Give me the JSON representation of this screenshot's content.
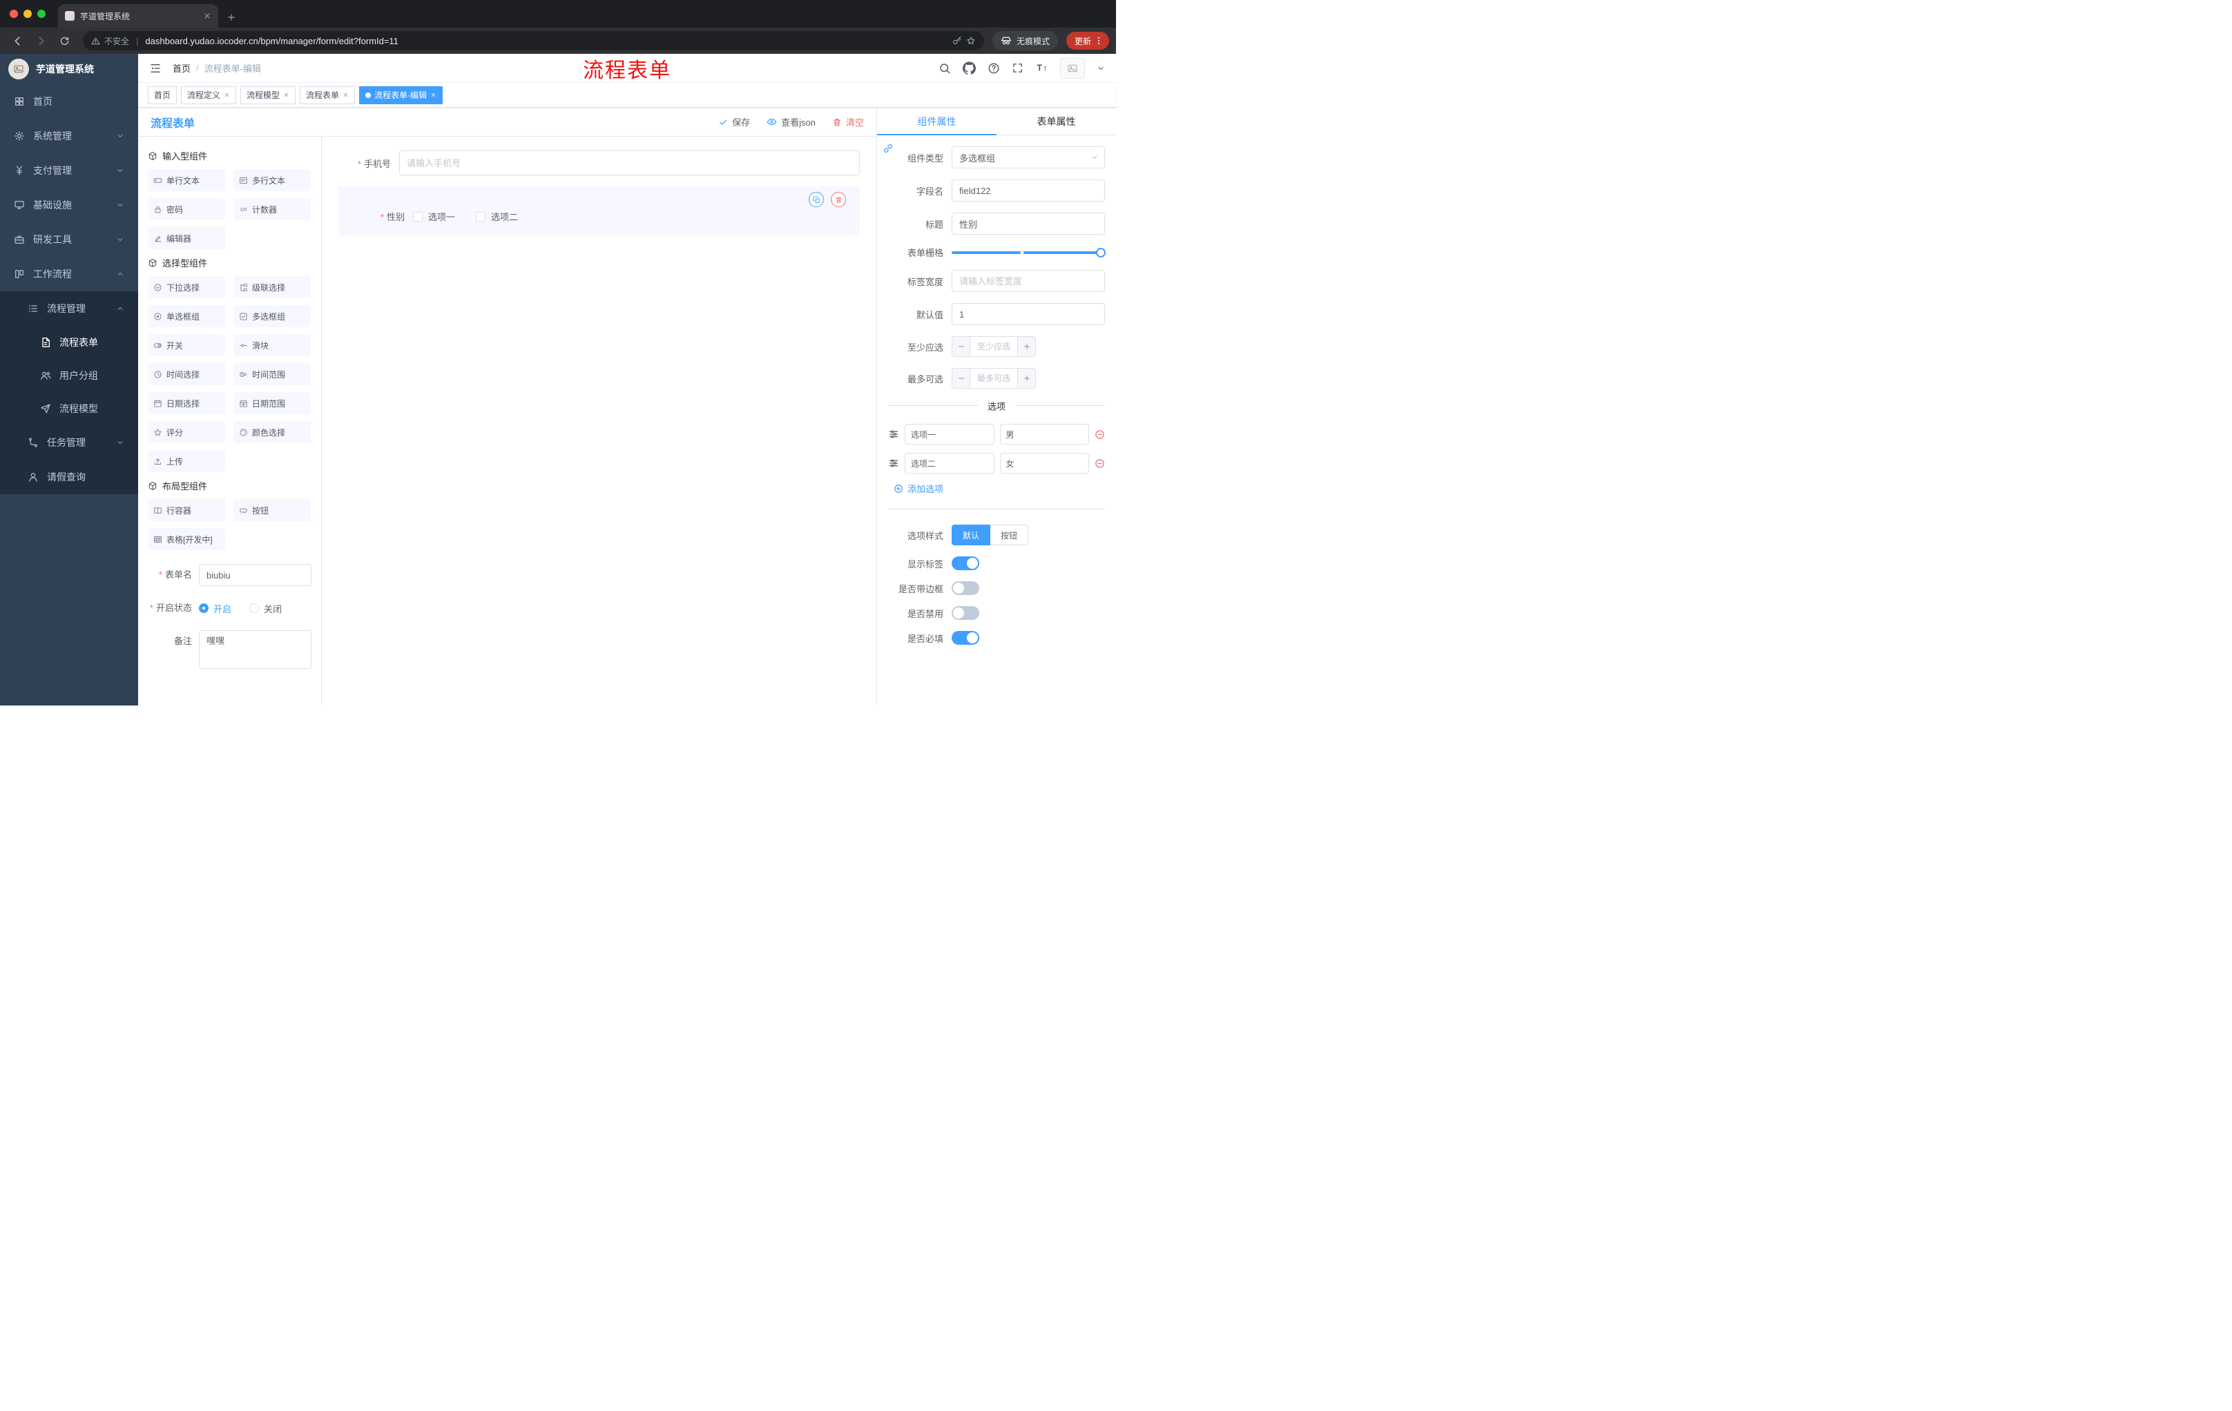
{
  "colors": {
    "accent": "#409EFF",
    "danger": "#F56C6C",
    "annotation_red": "#F50F0F",
    "sidebar_bg": "#304156",
    "submenu_bg": "#1F2D3D",
    "active_tag": "#409EFF"
  },
  "icons": [
    "search",
    "github",
    "help",
    "fullscreen",
    "font-size",
    "fold-menu",
    "chevron-down",
    "chevron-up",
    "back",
    "forward",
    "reload",
    "warning",
    "key",
    "star",
    "incognito",
    "more-vertical",
    "close",
    "plus",
    "check",
    "eye",
    "trash",
    "copy",
    "link",
    "plus-circle",
    "minus-circle",
    "drag-handle",
    "image-placeholder"
  ],
  "browser": {
    "tab": {
      "title": "芋道管理系统"
    },
    "address": {
      "security": "不安全",
      "url": "dashboard.yudao.iocoder.cn/bpm/manager/form/edit?formId=11"
    },
    "incognito_label": "无痕模式",
    "update_label": "更新"
  },
  "sidebar": {
    "logo_title": "芋道管理系统",
    "menu": [
      {
        "label": "首页"
      },
      {
        "label": "系统管理"
      },
      {
        "label": "支付管理"
      },
      {
        "label": "基础设施"
      },
      {
        "label": "研发工具"
      },
      {
        "label": "工作流程"
      }
    ],
    "submenu": {
      "process_mgmt": "流程管理",
      "process_form": "流程表单",
      "user_group": "用户分组",
      "process_model": "流程模型",
      "task_mgmt": "任务管理",
      "leave_query": "请假查询"
    }
  },
  "header": {
    "breadcrumb": [
      "首页",
      "流程表单-编辑"
    ],
    "separator": "/",
    "annotation": "流程表单"
  },
  "tags": [
    {
      "label": "首页",
      "closable": false,
      "active": false
    },
    {
      "label": "流程定义",
      "closable": true,
      "active": false
    },
    {
      "label": "流程模型",
      "closable": true,
      "active": false
    },
    {
      "label": "流程表单",
      "closable": true,
      "active": false
    },
    {
      "label": "流程表单-编辑",
      "closable": true,
      "active": true
    }
  ],
  "designer": {
    "title": "流程表单",
    "toolbar": {
      "save": "保存",
      "view_json": "查看json",
      "clear": "清空"
    },
    "palette": {
      "sections": [
        {
          "title": "输入型组件",
          "items": [
            "单行文本",
            "多行文本",
            "密码",
            "计数器",
            "编辑器"
          ]
        },
        {
          "title": "选择型组件",
          "items": [
            "下拉选择",
            "级联选择",
            "单选框组",
            "多选框组",
            "开关",
            "滑块",
            "时间选择",
            "时间范围",
            "日期选择",
            "日期范围",
            "评分",
            "颜色选择",
            "上传"
          ]
        },
        {
          "title": "布局型组件",
          "items": [
            "行容器",
            "按钮",
            "表格[开发中]"
          ]
        }
      ],
      "form": {
        "name_label": "表单名",
        "name_value": "biubiu",
        "status_label": "开启状态",
        "status_on": "开启",
        "status_off": "关闭",
        "remark_label": "备注",
        "remark_value": "嘿嘿"
      }
    },
    "canvas": {
      "phone": {
        "label": "手机号",
        "placeholder": "请输入手机号"
      },
      "gender": {
        "label": "性别",
        "options": [
          "选项一",
          "选项二"
        ]
      }
    },
    "props": {
      "tabs": [
        "组件属性",
        "表单属性"
      ],
      "component_type_label": "组件类型",
      "component_type_value": "多选框组",
      "field_name_label": "字段名",
      "field_name_value": "field122",
      "title_label": "标题",
      "title_value": "性别",
      "grid_label": "表单栅格",
      "label_width_label": "标签宽度",
      "label_width_placeholder": "请输入标签宽度",
      "default_label": "默认值",
      "default_value": "1",
      "min_label": "至少应选",
      "min_placeholder": "至少应选",
      "max_label": "最多可选",
      "max_placeholder": "最多可选",
      "options_title": "选项",
      "options": [
        {
          "label": "选项一",
          "value": "男"
        },
        {
          "label": "选项二",
          "value": "女"
        }
      ],
      "add_option": "添加选项",
      "option_style_label": "选项样式",
      "option_style_default": "默认",
      "option_style_button": "按钮",
      "toggles": [
        {
          "label": "显示标签",
          "on": true
        },
        {
          "label": "是否带边框",
          "on": false
        },
        {
          "label": "是否禁用",
          "on": false
        },
        {
          "label": "是否必填",
          "on": true
        }
      ]
    }
  }
}
